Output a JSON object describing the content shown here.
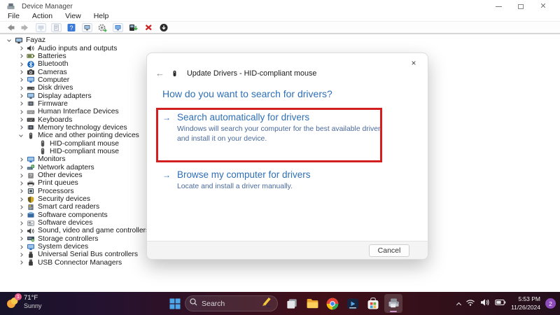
{
  "window": {
    "title": "Device Manager",
    "menus": [
      {
        "label": "File"
      },
      {
        "label": "Action"
      },
      {
        "label": "View"
      },
      {
        "label": "Help"
      }
    ]
  },
  "toolbar": {
    "icons": [
      {
        "name": "back"
      },
      {
        "name": "forward"
      },
      {
        "name": "show-console-tree"
      },
      {
        "name": "properties"
      },
      {
        "name": "help"
      },
      {
        "name": "computer"
      },
      {
        "name": "scan-hardware-changes"
      },
      {
        "name": "remote-computer"
      },
      {
        "name": "update-driver"
      },
      {
        "name": "uninstall-device"
      },
      {
        "name": "disable-device"
      }
    ]
  },
  "tree": {
    "items": [
      {
        "label": "Fayaz",
        "depth": 0,
        "state": "expanded",
        "icon": "monitor",
        "color": "#3a3a3a"
      },
      {
        "label": "Audio inputs and outputs",
        "depth": 1,
        "state": "collapsed",
        "icon": "speaker",
        "color": "#3a3a3a"
      },
      {
        "label": "Batteries",
        "depth": 1,
        "state": "collapsed",
        "icon": "battery",
        "color": "#55682b"
      },
      {
        "label": "Bluetooth",
        "depth": 1,
        "state": "collapsed",
        "icon": "bluetooth",
        "color": "#1566c0"
      },
      {
        "label": "Cameras",
        "depth": 1,
        "state": "collapsed",
        "icon": "camera",
        "color": "#3a3a3a"
      },
      {
        "label": "Computer",
        "depth": 1,
        "state": "collapsed",
        "icon": "monitor",
        "color": "#2f6fbe"
      },
      {
        "label": "Disk drives",
        "depth": 1,
        "state": "collapsed",
        "icon": "disk",
        "color": "#4a4a4a"
      },
      {
        "label": "Display adapters",
        "depth": 1,
        "state": "collapsed",
        "icon": "monitor",
        "color": "#44627a"
      },
      {
        "label": "Firmware",
        "depth": 1,
        "state": "collapsed",
        "icon": "chip",
        "color": "#4a4a4a"
      },
      {
        "label": "Human Interface Devices",
        "depth": 1,
        "state": "collapsed",
        "icon": "keyboard",
        "color": "#8a8a8a"
      },
      {
        "label": "Keyboards",
        "depth": 1,
        "state": "collapsed",
        "icon": "keyboard",
        "color": "#333333"
      },
      {
        "label": "Memory technology devices",
        "depth": 1,
        "state": "collapsed",
        "icon": "chip",
        "color": "#333333"
      },
      {
        "label": "Mice and other pointing devices",
        "depth": 1,
        "state": "expanded",
        "icon": "mouse",
        "color": "#4a4a4a"
      },
      {
        "label": "HID-compliant mouse",
        "depth": 2,
        "state": null,
        "icon": "mouse",
        "color": "#555555"
      },
      {
        "label": "HID-compliant mouse",
        "depth": 2,
        "state": null,
        "icon": "mouse",
        "color": "#555555"
      },
      {
        "label": "Monitors",
        "depth": 1,
        "state": "collapsed",
        "icon": "monitor",
        "color": "#2f6fbe"
      },
      {
        "label": "Network adapters",
        "depth": 1,
        "state": "collapsed",
        "icon": "netcard",
        "color": "#46627c"
      },
      {
        "label": "Other devices",
        "depth": 1,
        "state": "collapsed",
        "icon": "question",
        "color": "#8a8a8a"
      },
      {
        "label": "Print queues",
        "depth": 1,
        "state": "collapsed",
        "icon": "printer",
        "color": "#3a3a3a"
      },
      {
        "label": "Processors",
        "depth": 1,
        "state": "collapsed",
        "icon": "cpu",
        "color": "#37474f"
      },
      {
        "label": "Security devices",
        "depth": 1,
        "state": "collapsed",
        "icon": "shield",
        "color": "#6b5b1e"
      },
      {
        "label": "Smart card readers",
        "depth": 1,
        "state": "collapsed",
        "icon": "card",
        "color": "#6a7480"
      },
      {
        "label": "Software components",
        "depth": 1,
        "state": "collapsed",
        "icon": "component",
        "color": "#35689e"
      },
      {
        "label": "Software devices",
        "depth": 1,
        "state": "collapsed",
        "icon": "softdev",
        "color": "#6a7480"
      },
      {
        "label": "Sound, video and game controllers",
        "depth": 1,
        "state": "collapsed",
        "icon": "speaker",
        "color": "#3a3a3a"
      },
      {
        "label": "Storage controllers",
        "depth": 1,
        "state": "collapsed",
        "icon": "storagec",
        "color": "#3e4a5a"
      },
      {
        "label": "System devices",
        "depth": 1,
        "state": "collapsed",
        "icon": "monitor",
        "color": "#2f6fbe"
      },
      {
        "label": "Universal Serial Bus controllers",
        "depth": 1,
        "state": "collapsed",
        "icon": "usb",
        "color": "#3a3a3a"
      },
      {
        "label": "USB Connector Managers",
        "depth": 1,
        "state": "collapsed",
        "icon": "usb",
        "color": "#3a3a3a"
      }
    ]
  },
  "dialog": {
    "title": "Update Drivers - HID-compliant mouse",
    "heading": "How do you want to search for drivers?",
    "back_arrow": "←",
    "option_arrow": "→",
    "options": [
      {
        "title": "Search automatically for drivers",
        "desc": "Windows will search your computer for the best available driver and install it on your device.",
        "highlighted": true
      },
      {
        "title": "Browse my computer for drivers",
        "desc": "Locate and install a driver manually.",
        "highlighted": false
      }
    ],
    "cancel_label": "Cancel",
    "close_glyph": "×"
  },
  "taskbar": {
    "weather": {
      "temp": "71°F",
      "condition": "Sunny",
      "badge": "1"
    },
    "search_label": "Search",
    "apps": [
      {
        "name": "task-view",
        "active": false
      },
      {
        "name": "file-explorer",
        "active": false
      },
      {
        "name": "chrome",
        "active": false
      },
      {
        "name": "media-app",
        "active": false
      },
      {
        "name": "microsoft-store",
        "active": false
      },
      {
        "name": "device-manager",
        "active": true
      }
    ],
    "tray": {
      "time": "5:53 PM",
      "date": "11/26/2024",
      "badge": "2"
    }
  },
  "colors": {
    "link_blue": "#2e6fb7",
    "description_blue": "#49699c",
    "annotation_red": "#d21f1f",
    "tray_badge_purple": "#8d4bbb",
    "start_blue": "#4ba6ea"
  }
}
